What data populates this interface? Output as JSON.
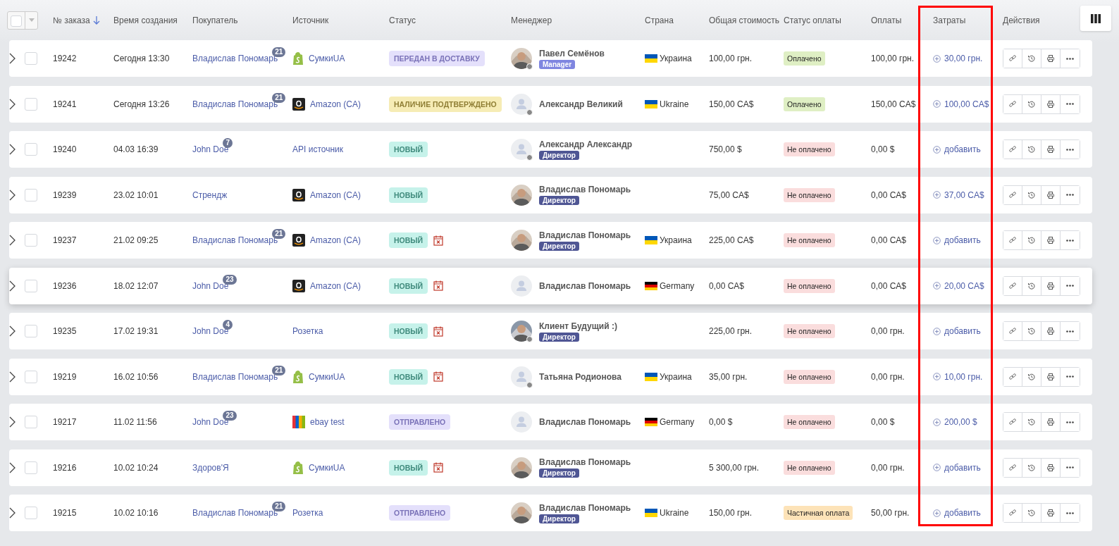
{
  "header": {
    "select_all": {
      "checked": false
    },
    "columns": [
      {
        "label": "№ заказа",
        "sorted": true,
        "highlighted": false
      },
      {
        "label": "Время создания",
        "sorted": false,
        "highlighted": false
      },
      {
        "label": "Покупатель",
        "sorted": false,
        "highlighted": false
      },
      {
        "label": "Источник",
        "sorted": false,
        "highlighted": false
      },
      {
        "label": "Статус",
        "sorted": false,
        "highlighted": false
      },
      {
        "label": "Менеджер",
        "sorted": false,
        "highlighted": false
      },
      {
        "label": "Страна",
        "sorted": false,
        "highlighted": false
      },
      {
        "label": "Общая стоимость",
        "sorted": false,
        "highlighted": false
      },
      {
        "label": "Статус оплаты",
        "sorted": false,
        "highlighted": false
      },
      {
        "label": "Оплаты",
        "sorted": false,
        "highlighted": false
      },
      {
        "label": "Затраты",
        "sorted": false,
        "highlighted": true
      },
      {
        "label": "Действия",
        "sorted": false,
        "highlighted": false
      }
    ]
  },
  "orders": [
    {
      "checked": false,
      "hovered": false,
      "number": "19242",
      "created": "Сегодня 13:30",
      "buyer": "Владислав Пономарь",
      "buyer_count": "21",
      "source": {
        "kind": "shopify",
        "name": "СумкиUA"
      },
      "status": {
        "kind": "delivery",
        "label": "ПЕРЕДАН В ДОСТАВКУ"
      },
      "overdue": false,
      "manager": {
        "online_dot": true,
        "name": "Павел Семёнов",
        "role": {
          "kind": "manager",
          "label": "Manager"
        }
      },
      "country": {
        "kind": "ua",
        "name": "Украина"
      },
      "total": "100,00 грн.",
      "payment_status": {
        "kind": "paid",
        "label": "Оплачено"
      },
      "payments": "100,00 грн.",
      "costs": "30,00 грн."
    },
    {
      "checked": false,
      "hovered": false,
      "number": "19241",
      "created": "Сегодня 13:26",
      "buyer": "Владислав Пономарь",
      "buyer_count": "21",
      "source": {
        "kind": "amazon",
        "name": "Amazon (CA)"
      },
      "status": {
        "kind": "confirmed",
        "label": "НАЛИЧИЕ ПОДТВЕРЖДЕНО"
      },
      "overdue": false,
      "manager": {
        "kind": "placeholder",
        "online_dot": true,
        "name": "Александр Великий"
      },
      "country": {
        "kind": "ua",
        "name": "Ukraine"
      },
      "total": "150,00 CA$",
      "payment_status": {
        "kind": "paid",
        "label": "Оплачено"
      },
      "payments": "150,00 CA$",
      "costs": "100,00 CA$"
    },
    {
      "checked": false,
      "hovered": false,
      "number": "19240",
      "created": "04.03 16:39",
      "buyer": "John Doe",
      "buyer_count": "7",
      "source": {
        "kind": "none",
        "name": "API источник"
      },
      "status": {
        "kind": "new",
        "label": "НОВЫЙ"
      },
      "overdue": false,
      "manager": {
        "kind": "placeholder",
        "online_dot": true,
        "name": "Александр Александр",
        "role": {
          "kind": "director",
          "label": "Директор"
        }
      },
      "total": "750,00 $",
      "payment_status": {
        "kind": "unpaid",
        "label": "Не оплачено"
      },
      "payments": "0,00 $",
      "costs": "добавить"
    },
    {
      "checked": false,
      "hovered": false,
      "number": "19239",
      "created": "23.02 10:01",
      "buyer": "Стрендж",
      "source": {
        "kind": "amazon",
        "name": "Amazon (CA)"
      },
      "status": {
        "kind": "new",
        "label": "НОВЫЙ"
      },
      "overdue": false,
      "manager": {
        "online_dot": false,
        "name": "Владислав Пономарь",
        "role": {
          "kind": "director",
          "label": "Директор"
        }
      },
      "total": "75,00 CA$",
      "payment_status": {
        "kind": "unpaid",
        "label": "Не оплачено"
      },
      "payments": "0,00 CA$",
      "costs": "37,00 CA$"
    },
    {
      "checked": false,
      "hovered": false,
      "number": "19237",
      "created": "21.02 09:25",
      "buyer": "Владислав Пономарь",
      "buyer_count": "21",
      "source": {
        "kind": "amazon",
        "name": "Amazon (CA)"
      },
      "status": {
        "kind": "new",
        "label": "НОВЫЙ"
      },
      "overdue": true,
      "manager": {
        "online_dot": false,
        "name": "Владислав Пономарь",
        "role": {
          "kind": "director",
          "label": "Директор"
        }
      },
      "country": {
        "kind": "ua",
        "name": "Украина"
      },
      "total": "225,00 CA$",
      "payment_status": {
        "kind": "unpaid",
        "label": "Не оплачено"
      },
      "payments": "0,00 CA$",
      "costs": "добавить"
    },
    {
      "checked": false,
      "hovered": true,
      "number": "19236",
      "created": "18.02 12:07",
      "buyer": "John Doe",
      "buyer_count": "23",
      "source": {
        "kind": "amazon",
        "name": "Amazon (CA)"
      },
      "status": {
        "kind": "new",
        "label": "НОВЫЙ"
      },
      "overdue": true,
      "manager": {
        "kind": "placeholder",
        "online_dot": false,
        "name": "Владислав Пономарь"
      },
      "country": {
        "kind": "de",
        "name": "Germany"
      },
      "total": "0,00 CA$",
      "payment_status": {
        "kind": "unpaid",
        "label": "Не оплачено"
      },
      "payments": "0,00 CA$",
      "costs": "20,00 CA$"
    },
    {
      "checked": false,
      "hovered": false,
      "number": "19235",
      "created": "17.02 19:31",
      "buyer": "John Doe",
      "buyer_count": "4",
      "source": {
        "kind": "none",
        "name": "Розетка"
      },
      "status": {
        "kind": "new",
        "label": "НОВЫЙ"
      },
      "overdue": true,
      "manager": {
        "online_dot": true,
        "name": "Клиент Будущий :)",
        "role": {
          "kind": "director",
          "label": "Директор"
        }
      },
      "total": "225,00 грн.",
      "payment_status": {
        "kind": "unpaid",
        "label": "Не оплачено"
      },
      "payments": "0,00 грн.",
      "costs": "добавить"
    },
    {
      "checked": false,
      "hovered": false,
      "number": "19219",
      "created": "16.02 10:56",
      "buyer": "Владислав Пономарь",
      "buyer_count": "21",
      "source": {
        "kind": "shopify",
        "name": "СумкиUA"
      },
      "status": {
        "kind": "new",
        "label": "НОВЫЙ"
      },
      "overdue": true,
      "manager": {
        "kind": "placeholder",
        "online_dot": true,
        "name": "Татьяна Родионова"
      },
      "country": {
        "kind": "ua",
        "name": "Украина"
      },
      "total": "35,00 грн.",
      "payment_status": {
        "kind": "unpaid",
        "label": "Не оплачено"
      },
      "payments": "0,00 грн.",
      "costs": "10,00 грн."
    },
    {
      "checked": false,
      "hovered": false,
      "number": "19217",
      "created": "11.02 11:56",
      "buyer": "John Doe",
      "buyer_count": "23",
      "source": {
        "kind": "ebay",
        "name": "ebay test"
      },
      "status": {
        "kind": "sent",
        "label": "ОТПРАВЛЕНО"
      },
      "overdue": false,
      "manager": {
        "kind": "placeholder",
        "online_dot": false,
        "name": "Владислав Пономарь"
      },
      "country": {
        "kind": "de",
        "name": "Germany"
      },
      "total": "0,00 $",
      "payment_status": {
        "kind": "unpaid",
        "label": "Не оплачено"
      },
      "payments": "0,00 $",
      "costs": "200,00 $"
    },
    {
      "checked": false,
      "hovered": false,
      "number": "19216",
      "created": "10.02 10:24",
      "buyer": "Здоров'Я",
      "source": {
        "kind": "shopify",
        "name": "СумкиUA"
      },
      "status": {
        "kind": "new",
        "label": "НОВЫЙ"
      },
      "overdue": true,
      "manager": {
        "online_dot": false,
        "name": "Владислав Пономарь",
        "role": {
          "kind": "director",
          "label": "Директор"
        }
      },
      "total": "5 300,00 грн.",
      "payment_status": {
        "kind": "unpaid",
        "label": "Не оплачено"
      },
      "payments": "0,00 грн.",
      "costs": "добавить"
    },
    {
      "checked": false,
      "hovered": false,
      "number": "19215",
      "created": "10.02 10:16",
      "buyer": "Владислав Пономарь",
      "buyer_count": "21",
      "source": {
        "kind": "none",
        "name": "Розетка"
      },
      "status": {
        "kind": "sent",
        "label": "ОТПРАВЛЕНО"
      },
      "overdue": false,
      "manager": {
        "online_dot": false,
        "name": "Владислав Пономарь",
        "role": {
          "kind": "director",
          "label": "Директор"
        }
      },
      "country": {
        "kind": "ua",
        "name": "Ukraine"
      },
      "total": "150,00 грн.",
      "payment_status": {
        "kind": "partial",
        "label": "Частичная оплата"
      },
      "payments": "50,00 грн.",
      "costs": "добавить"
    }
  ]
}
